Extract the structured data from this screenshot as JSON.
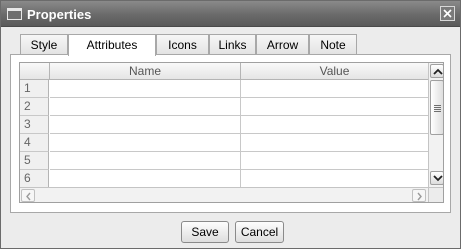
{
  "window": {
    "title": "Properties",
    "icon": "window-icon",
    "close_icon": "close-icon"
  },
  "tabs": [
    {
      "label": "Style",
      "active": false
    },
    {
      "label": "Attributes",
      "active": true
    },
    {
      "label": "Icons",
      "active": false
    },
    {
      "label": "Links",
      "active": false
    },
    {
      "label": "Arrow",
      "active": false
    },
    {
      "label": "Note",
      "active": false
    }
  ],
  "table": {
    "columns": [
      "Name",
      "Value"
    ],
    "rows": [
      {
        "num": "1",
        "name": "",
        "value": ""
      },
      {
        "num": "2",
        "name": "",
        "value": ""
      },
      {
        "num": "3",
        "name": "",
        "value": ""
      },
      {
        "num": "4",
        "name": "",
        "value": ""
      },
      {
        "num": "5",
        "name": "",
        "value": ""
      },
      {
        "num": "6",
        "name": "",
        "value": ""
      }
    ]
  },
  "buttons": {
    "save": "Save",
    "cancel": "Cancel"
  },
  "colors": {
    "titlebar": "#6a6a6a",
    "panel": "#ffffff",
    "dialog_bg": "#ececec"
  }
}
